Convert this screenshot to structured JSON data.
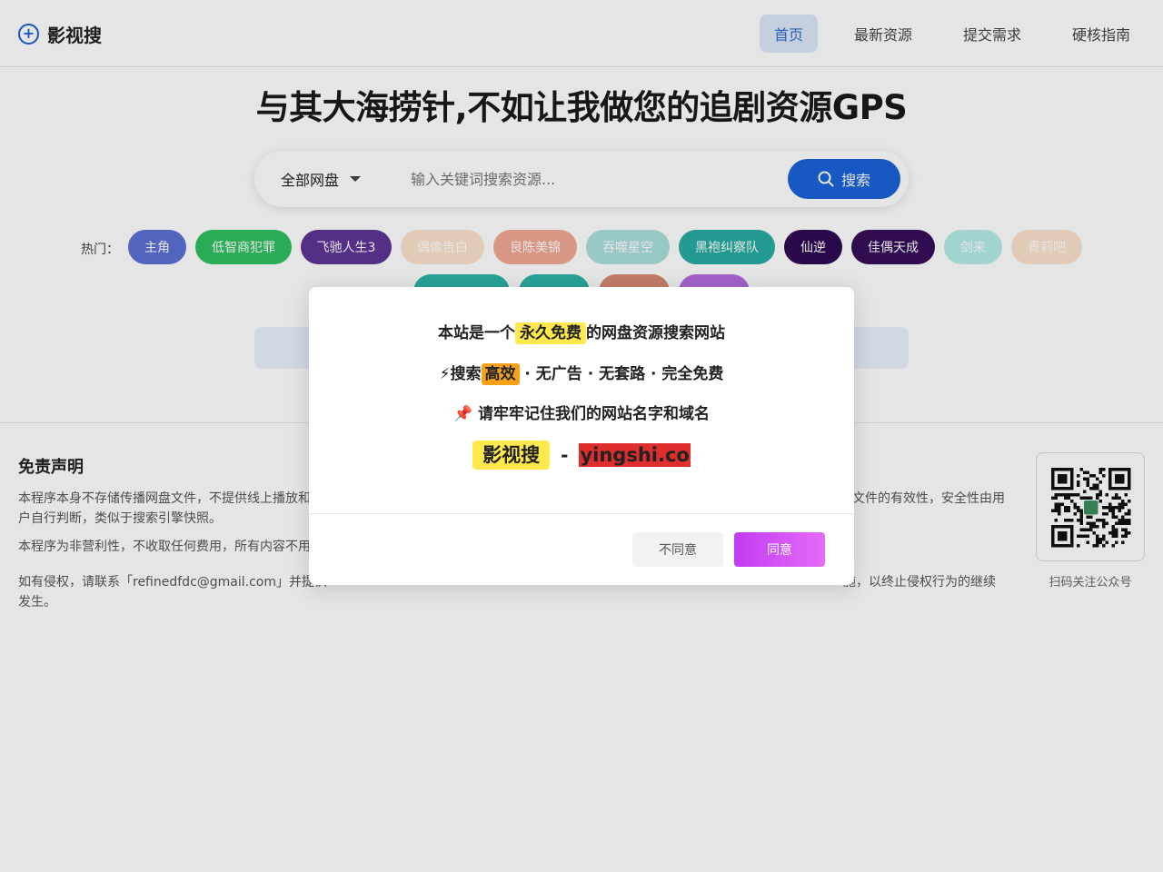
{
  "header": {
    "brand_icon": "plus-circle-icon",
    "brand": "影视搜",
    "nav": [
      "首页",
      "最新资源",
      "提交需求",
      "硬核指南"
    ],
    "active_nav": "首页"
  },
  "hero": {
    "title": "与其大海捞针,不如让我做您的追剧资源GPS"
  },
  "search": {
    "disk_select": "全部网盘",
    "placeholder": "输入关键词搜索资源...",
    "button_label": "搜索",
    "button_icon": "search-icon"
  },
  "hot": {
    "label": "热门：",
    "tags": [
      {
        "label": "主角",
        "color": "#5c70d4"
      },
      {
        "label": "低智商犯罪",
        "color": "#2fbf5f"
      },
      {
        "label": "飞驰人生3",
        "color": "#5f3596"
      },
      {
        "label": "偶像告白",
        "color": "#fbe3cc"
      },
      {
        "label": "良陈美锦",
        "color": "#f1a894"
      },
      {
        "label": "吞噬星空",
        "color": "#aadfdc"
      },
      {
        "label": "黑袍纠察队",
        "color": "#26aca2"
      },
      {
        "label": "仙逆",
        "color": "#2e0b52"
      },
      {
        "label": "佳偶天成",
        "color": "#360d5a"
      },
      {
        "label": "剑来",
        "color": "#b5ece7"
      },
      {
        "label": "青莉吧",
        "color": "#fbe3cc"
      }
    ],
    "row2_colors": [
      "#2cb5a7",
      "#2cb5a7",
      "#d98b74",
      "#b66ce0"
    ]
  },
  "footer": {
    "disclaimer_title": "免责声明",
    "para1_left": "本程序本身不存储传播网盘文件，不提供线上播放和",
    "para1_right": "文件的有效性，安全性由用",
    "para1_line2": "户自行判断，类似于搜索引擎快照。",
    "para2": "本程序为非营利性，不收取任何费用，所有内容不用",
    "para3_left": "如有侵权，请联系「refinedfdc@gmail.com」并提供",
    "para3_right": "施，以终止侵权行为的继续",
    "para3_line2": "发生。",
    "qr_caption": "扫码关注公众号"
  },
  "modal": {
    "l1_pre": "本站是一个",
    "l1_hl": "永久免费",
    "l1_post": "的网盘资源搜索网站",
    "l2_icon": "lightning-icon",
    "l2_emoji": "⚡",
    "l2_pre": "搜索",
    "l2_hl": "高效",
    "l2_post": " · 无广告 · 无套路 · 完全免费",
    "l3_icon": "pushpin-icon",
    "l3_emoji": "📌",
    "l3_text": " 请牢牢记住我们的网站名字和域名",
    "brand": "影视搜",
    "sep": "-",
    "domain": "yingshi.co",
    "disagree": "不同意",
    "agree": "同意"
  }
}
